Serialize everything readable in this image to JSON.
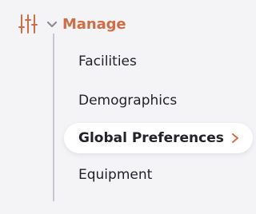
{
  "section": {
    "title": "Manage",
    "icon": "sliders-icon",
    "toggle_icon": "chevron-down-icon",
    "accent_color": "#cd6e47"
  },
  "items": [
    {
      "label": "Facilities",
      "active": false
    },
    {
      "label": "Demographics",
      "active": false
    },
    {
      "label": "Global Preferences",
      "active": true,
      "icon": "chevron-right-icon"
    },
    {
      "label": "Equipment",
      "active": false
    }
  ],
  "colors": {
    "text": "#23222b",
    "tree_line": "#c8c6d3",
    "background": "#f4f3f6",
    "active_background": "#ffffff"
  }
}
